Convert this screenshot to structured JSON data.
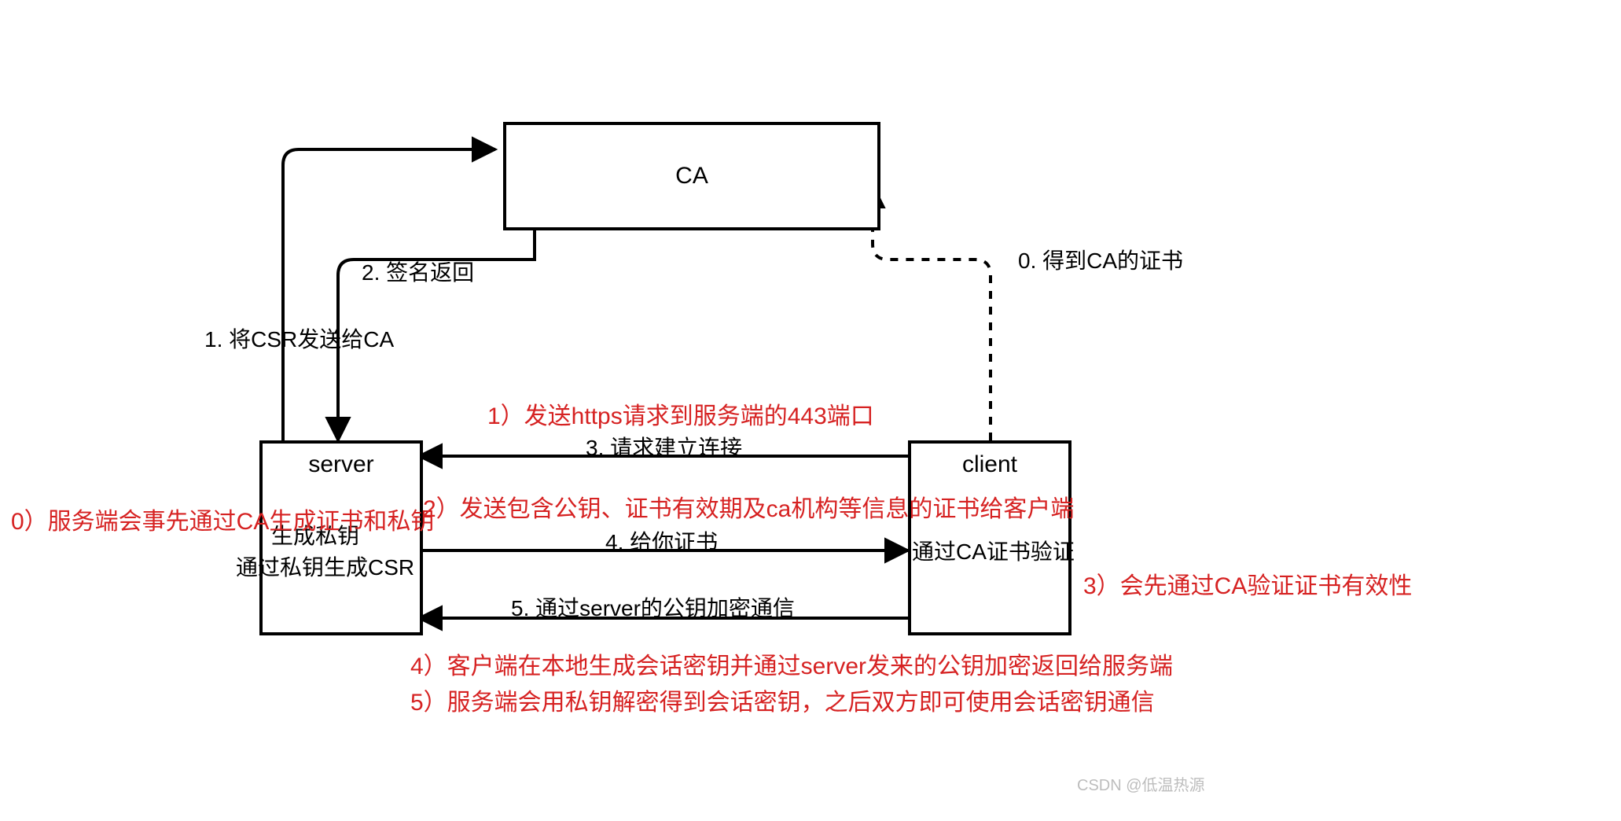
{
  "nodes": {
    "ca": "CA",
    "server": "server",
    "client": "client",
    "server_sub1": "生成私钥",
    "server_sub2": "通过私钥生成CSR",
    "client_sub": "通过CA证书验证"
  },
  "edges": {
    "e0": "0. 得到CA的证书",
    "e1": "1. 将CSR发送给CA",
    "e2": "2. 签名返回",
    "e3": "3. 请求建立连接",
    "e4": "4. 给你证书",
    "e5": "5. 通过server的公钥加密通信"
  },
  "annotations": {
    "a0": "0）服务端会事先通过CA生成证书和私钥",
    "a1": "1）发送https请求到服务端的443端口",
    "a2": "2）发送包含公钥、证书有效期及ca机构等信息的证书给客户端",
    "a3": "3）会先通过CA验证证书有效性",
    "a4": "4）客户端在本地生成会话密钥并通过server发来的公钥加密返回给服务端",
    "a5": "5）服务端会用私钥解密得到会话密钥，之后双方即可使用会话密钥通信"
  },
  "watermark": "CSDN @低温热源"
}
